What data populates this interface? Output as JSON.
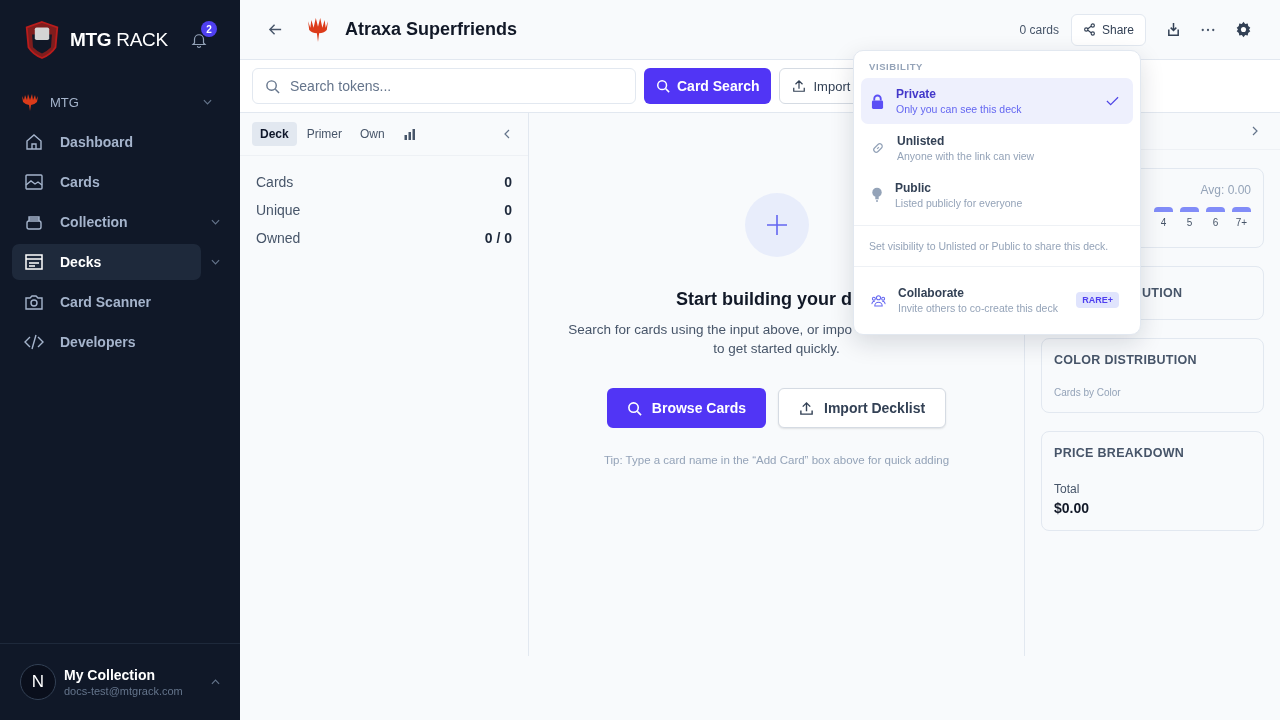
{
  "sidebar": {
    "brand": {
      "strong": "MTG",
      "light": "RACK"
    },
    "notification_count": "2",
    "game": {
      "label": "MTG",
      "expandable": true
    },
    "nav": [
      {
        "kind": "home",
        "label": "Dashboard",
        "selected": false,
        "expandable": false
      },
      {
        "kind": "image",
        "label": "Cards",
        "selected": false,
        "expandable": false
      },
      {
        "kind": "box",
        "label": "Collection",
        "selected": false,
        "expandable": true
      },
      {
        "kind": "deck",
        "label": "Decks",
        "selected": true,
        "expandable": true
      },
      {
        "kind": "camera",
        "label": "Card Scanner",
        "selected": false,
        "expandable": false
      },
      {
        "kind": "code",
        "label": "Developers",
        "selected": false,
        "expandable": false
      }
    ],
    "user": {
      "initial": "N",
      "name": "My Collection",
      "email": "docs-test@mtgrack.com"
    }
  },
  "header": {
    "title": "Atraxa Superfriends",
    "card_count": "0 cards",
    "share": "Share"
  },
  "toolbar": {
    "search": {
      "placeholder": "Search tokens..."
    },
    "card_search": "Card Search",
    "import": "Import"
  },
  "left_panel": {
    "tabs": [
      {
        "kind": "text",
        "label": "Deck",
        "selected": true
      },
      {
        "kind": "text",
        "label": "Primer",
        "selected": false
      },
      {
        "kind": "text",
        "label": "Own",
        "selected": false
      },
      {
        "kind": "chart",
        "selected": false
      }
    ],
    "stats": [
      {
        "label": "Cards",
        "value": "0"
      },
      {
        "label": "Unique",
        "value": "0"
      },
      {
        "label": "Owned",
        "value": "0 / 0"
      }
    ]
  },
  "empty_state": {
    "heading": "Start building your d",
    "description_1": "Search for cards using the input above, or impo",
    "description_2": "to get started quickly.",
    "browse": "Browse Cards",
    "import": "Import Decklist",
    "tip": "Tip: Type a card name in the “Add Card” box above for quick adding"
  },
  "right_panel": {
    "curve": {
      "average": "Avg: 0.00",
      "labels": [
        "4",
        "5",
        "6",
        "7+"
      ]
    },
    "distribution_partial": "UTION",
    "color_distribution": {
      "title": "COLOR DISTRIBUTION",
      "subtitle": "Cards by Color"
    },
    "price": {
      "title": "PRICE BREAKDOWN",
      "label": "Total",
      "value": "$0.00"
    }
  },
  "visibility_menu": {
    "heading": "VISIBILITY",
    "options": [
      {
        "kind": "lock",
        "title": "Private",
        "description": "Only you can see this deck",
        "selected": true
      },
      {
        "kind": "link",
        "title": "Unlisted",
        "description": "Anyone with the link can view",
        "selected": false
      },
      {
        "kind": "bulb",
        "title": "Public",
        "description": "Listed publicly for everyone",
        "selected": false
      }
    ],
    "note": "Set visibility to Unlisted or Public to share this deck.",
    "collaborate": {
      "title": "Collaborate",
      "description": "Invite others to co-create this deck",
      "badge": "RARE+"
    }
  }
}
